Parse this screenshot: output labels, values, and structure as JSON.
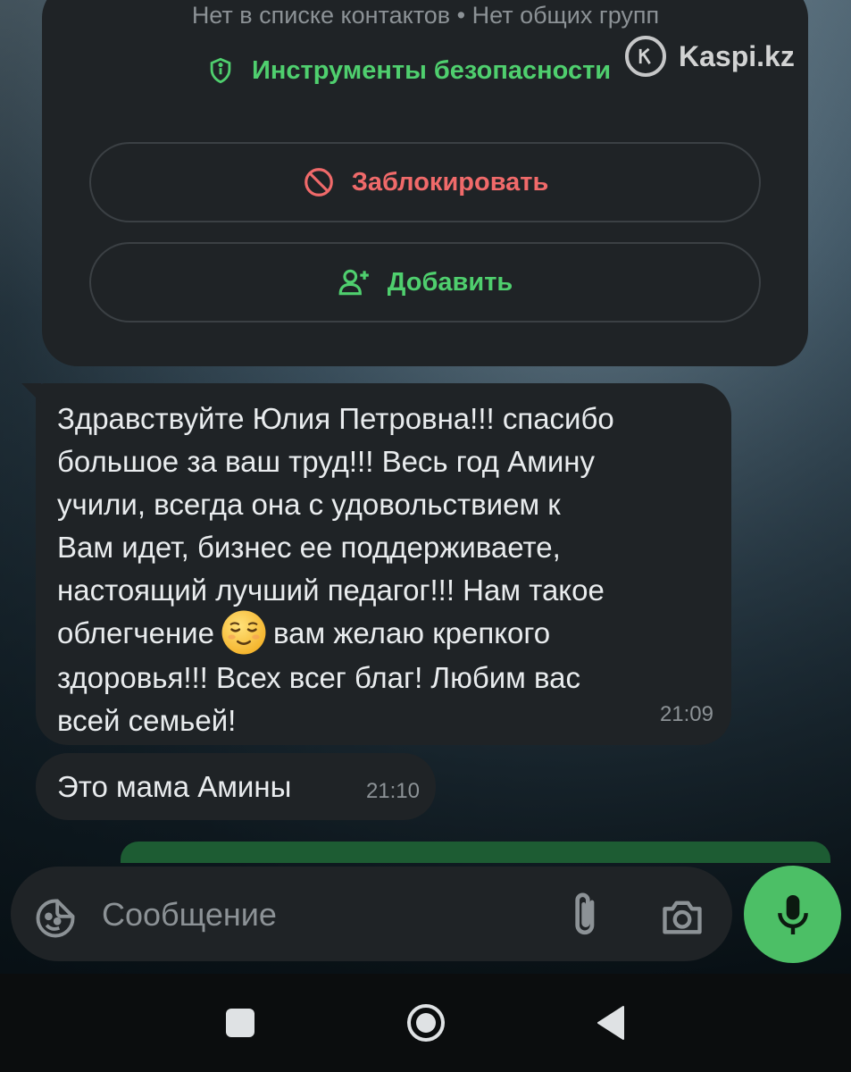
{
  "contact_info": {
    "status_line": "Нет в списке контактов • Нет общих групп",
    "security_tools_label": "Инструменты безопасности",
    "block_label": "Заблокировать",
    "add_label": "Добавить"
  },
  "watermark": {
    "text": "Kaspi.kz"
  },
  "messages": [
    {
      "text": "Здравствуйте Юлия Петровна!!! спасибо\nбольшое за ваш труд!!! Весь год Амину\nучили, всегда она с удовольствием к\nВам идет, бизнес ее поддерживаете,\nнастоящий лучший педагог!!! Нам такое\nоблегчение",
      "emoji": "relieved-face",
      "text_after": "вам желаю крепкого\nздоровья!!! Всех всег благ! Любим вас\nвсей семьей!",
      "time": "21:09"
    },
    {
      "text": "Это мама Амины",
      "time": "21:10"
    }
  ],
  "composer": {
    "placeholder": "Сообщение"
  },
  "colors": {
    "accent_green": "#4fcf6e",
    "danger_red": "#f06a6a",
    "bubble_bg": "#1f2326",
    "mic_button": "#4cbf66"
  },
  "icons": [
    "shield-icon",
    "block-icon",
    "add-user-icon",
    "sticker-icon",
    "attach-icon",
    "camera-icon",
    "mic-icon",
    "nav-recents-icon",
    "nav-home-icon",
    "nav-back-icon"
  ]
}
